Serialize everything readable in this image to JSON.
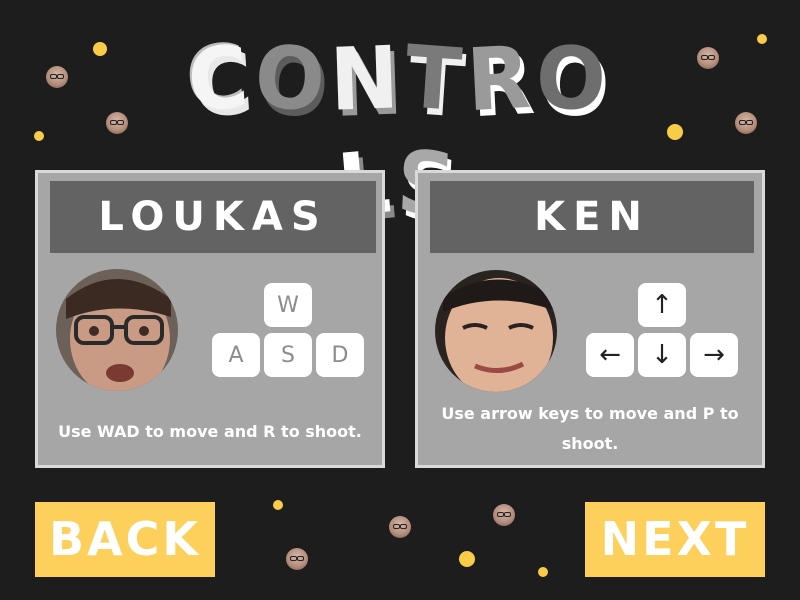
{
  "title": {
    "letters": [
      "C",
      "O",
      "N",
      "T",
      "R",
      "O",
      "L",
      "S"
    ]
  },
  "players": [
    {
      "name": "LOUKAS",
      "portrait_icon": "player-face-photo",
      "keys": {
        "up": "W",
        "row": [
          "A",
          "S",
          "D"
        ]
      },
      "description": "Use WAD to move and R to shoot."
    },
    {
      "name": "KEN",
      "portrait_icon": "player-face-photo",
      "keys": {
        "up": "↑",
        "row": [
          "←",
          "↓",
          "→"
        ]
      },
      "description": "Use arrow keys to move and P to shoot."
    }
  ],
  "buttons": {
    "back": "BACK",
    "next": "NEXT"
  },
  "colors": {
    "background": "#1e1d1d",
    "card": "#a6a6a6",
    "name_bar": "#636363",
    "button": "#fdd05c",
    "dot": "#f9cc47"
  }
}
